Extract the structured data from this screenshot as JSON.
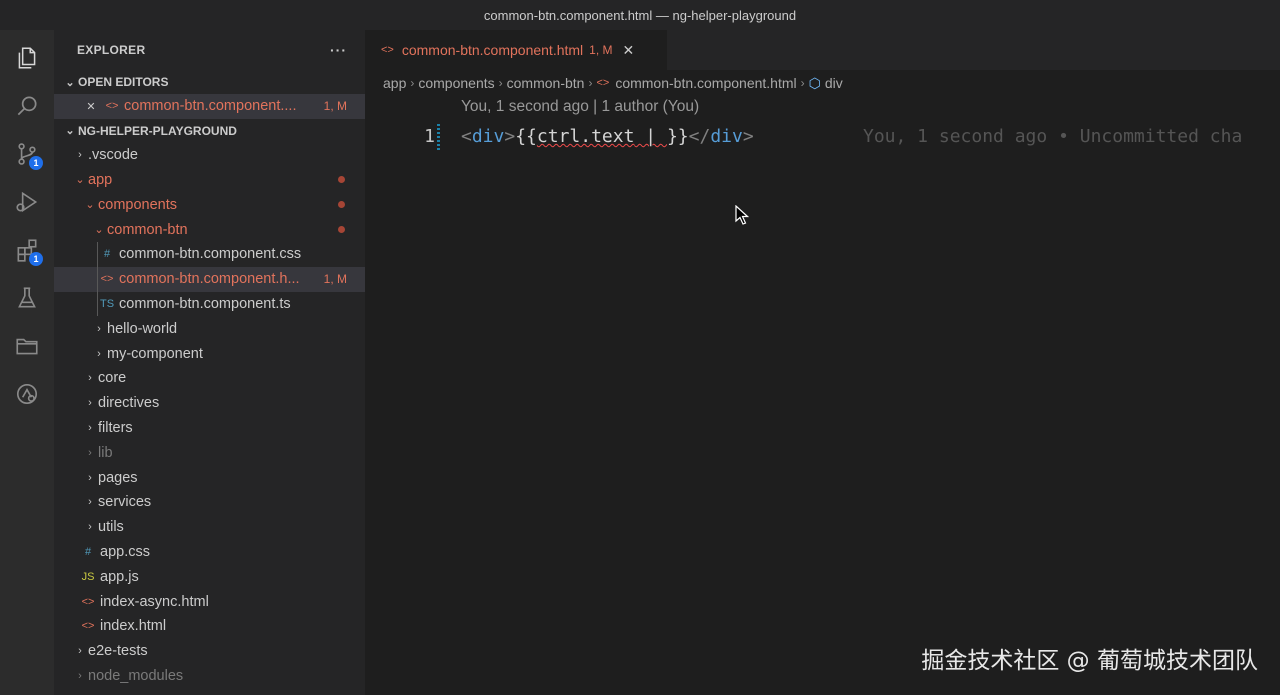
{
  "window_title": "common-btn.component.html — ng-helper-playground",
  "activity_bar": [
    {
      "name": "explorer-icon",
      "badge": ""
    },
    {
      "name": "search-icon",
      "badge": ""
    },
    {
      "name": "source-control-icon",
      "badge": "1"
    },
    {
      "name": "run-debug-icon",
      "badge": ""
    },
    {
      "name": "extensions-icon",
      "badge": "1"
    },
    {
      "name": "testing-icon",
      "badge": ""
    },
    {
      "name": "folder-icon",
      "badge": ""
    },
    {
      "name": "remote-icon",
      "badge": ""
    }
  ],
  "explorer": {
    "title": "EXPLORER",
    "more": "···",
    "open_editors": {
      "title": "OPEN EDITORS",
      "items": [
        {
          "close": "✕",
          "icon": "<>",
          "label": "common-btn.component....",
          "status": "1, M"
        }
      ]
    },
    "project": {
      "title": "NG-HELPER-PLAYGROUND",
      "tree": [
        {
          "chevron": "›",
          "label": ".vscode"
        },
        {
          "chevron": "⌄",
          "label": "app"
        },
        {
          "chevron": "⌄",
          "label": "components"
        },
        {
          "chevron": "⌄",
          "label": "common-btn"
        },
        {
          "icon": "#",
          "label": "common-btn.component.css"
        },
        {
          "icon": "<>",
          "label": "common-btn.component.h...",
          "status": "1, M"
        },
        {
          "icon": "TS",
          "label": "common-btn.component.ts"
        },
        {
          "chevron": "›",
          "label": "hello-world"
        },
        {
          "chevron": "›",
          "label": "my-component"
        },
        {
          "chevron": "›",
          "label": "core"
        },
        {
          "chevron": "›",
          "label": "directives"
        },
        {
          "chevron": "›",
          "label": "filters"
        },
        {
          "chevron": "›",
          "label": "lib"
        },
        {
          "chevron": "›",
          "label": "pages"
        },
        {
          "chevron": "›",
          "label": "services"
        },
        {
          "chevron": "›",
          "label": "utils"
        },
        {
          "icon": "#",
          "label": "app.css"
        },
        {
          "icon": "JS",
          "label": "app.js"
        },
        {
          "icon": "<>",
          "label": "index-async.html"
        },
        {
          "icon": "<>",
          "label": "index.html"
        },
        {
          "chevron": "›",
          "label": "e2e-tests"
        },
        {
          "chevron": "›",
          "label": "node_modules"
        }
      ]
    }
  },
  "editor": {
    "tab": {
      "icon": "<>",
      "label": "common-btn.component.html",
      "status": "1, M",
      "close": "✕"
    },
    "breadcrumb": [
      "app",
      "components",
      "common-btn",
      "common-btn.component.html",
      "div"
    ],
    "codelens": "You, 1 second ago | 1 author (You)",
    "line_number": "1",
    "code": {
      "open_lt": "<",
      "open_tag": "div",
      "open_gt": ">",
      "interp_open": "{{",
      "expr": "ctrl.text",
      "pipe": " | ",
      "interp_close": "}}",
      "close_lt": "</",
      "close_tag": "div",
      "close_gt": ">"
    },
    "blame": "You, 1 second ago • Uncommitted cha"
  },
  "watermark": "掘金技术社区 @ 葡萄城技术团队"
}
